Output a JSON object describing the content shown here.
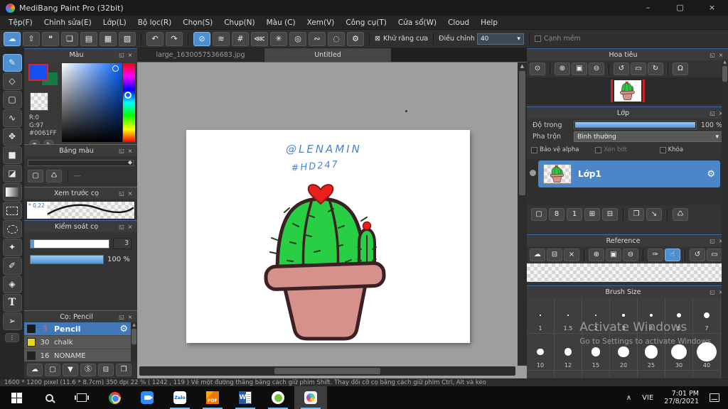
{
  "window": {
    "title": "MediBang Paint Pro (32bit)"
  },
  "menubar": {
    "items": [
      "Tệp(F)",
      "Chỉnh sửa(E)",
      "Lớp(L)",
      "Bộ lọc(R)",
      "Chọn(S)",
      "Chụp(N)",
      "Màu (C)",
      "Xem(V)",
      "Công cụ(T)",
      "Cửa sổ(W)",
      "Cloud",
      "Help"
    ]
  },
  "toolbar": {
    "antialias_label": "Khử răng cưa",
    "adjust_label": "Điều chỉnh",
    "adjust_value": "40",
    "soft_edge_label": "Cạnh mềm"
  },
  "tabs": {
    "tab1": "large_1630057536683.jpg",
    "tab2": "Untitled"
  },
  "canvas": {
    "signature_line1": "@LENAMIN",
    "signature_line2": "#HD247"
  },
  "color_panel": {
    "title": "Màu",
    "r": "R:0",
    "g": "G:97",
    "hex": "#0061FF",
    "fg": "#1650f0",
    "bg": "#157a43"
  },
  "palette_panel": {
    "title": "Bảng màu",
    "empty": "---"
  },
  "preview_panel": {
    "title": "Xem trước cọ",
    "value": "* 0.22"
  },
  "control_panel": {
    "title": "Kiểm soát cọ",
    "size": "3",
    "opacity": "100 %"
  },
  "brush_panel": {
    "title": "Cọ: Pencil",
    "brushes": [
      {
        "size": "3",
        "name": "Pencil",
        "swatch": "#1a1a1a",
        "selected": true
      },
      {
        "size": "30",
        "name": "chalk",
        "swatch": "#e8d51e",
        "selected": false
      },
      {
        "size": "16",
        "name": "NONAME",
        "swatch": "#222222",
        "selected": false
      }
    ]
  },
  "navigator_panel": {
    "title": "Hoa tiêu"
  },
  "layer_panel": {
    "title": "Lớp",
    "opacity_label": "Độ trong",
    "opacity_value": "100 %",
    "blend_label": "Pha trộn",
    "blend_value": "Bình thường",
    "check1": "Bảo vệ alpha",
    "check2": "Xén bớt",
    "check3": "Khóa",
    "layer1": "Lớp1"
  },
  "reference_panel": {
    "title": "Reference"
  },
  "brush_size_panel": {
    "title": "Brush Size",
    "rows": [
      [
        1,
        1.5,
        2,
        3,
        4,
        5,
        7
      ],
      [
        10,
        12,
        15,
        20,
        25,
        30,
        40
      ]
    ],
    "row3_count": 7
  },
  "statusbar": {
    "text": "1600 * 1200 pixel   (11.6 * 8.7cm)   350 dpi   22 %   ( 1242 ,  119 )   Vẽ một đường thẳng bằng cách giữ phím Shift. Thay đổi cỡ cọ bằng cách giữ phím Ctrl, Alt và kéo"
  },
  "watermark": {
    "line1": "Activate Windows",
    "line2": "Go to Settings to activate Windows"
  },
  "taskbar": {
    "language": "VIE",
    "time": "7:01 PM",
    "date": "27/8/2021",
    "zalo_label": "Zalo",
    "pdf_label": "PDF",
    "word_label": "W"
  },
  "colors": {
    "accent_blue": "#4d8fd1",
    "selection_blue": "#4178b8",
    "slider_blue": "#5b9bd5",
    "fg_color": "#0061FF",
    "cactus_green": "#28cf45",
    "pot_pink": "#d6918a",
    "outline_maroon": "#3d1f26",
    "heart_red": "#e8211b"
  },
  "icons": {
    "cloud": "☁",
    "share": "⇧",
    "chat": "❝",
    "comment": "❏",
    "doc": "▤",
    "doc_gear": "▦",
    "material": "▧",
    "undo": "↶",
    "redo": "↷",
    "snap_off": "⊘",
    "snap_para": "≋",
    "snap_grid": "#",
    "snap_vanish": "⋘",
    "snap_radial": "✳",
    "snap_circle": "◎",
    "snap_curve": "∾",
    "snap_ellipse": "◌",
    "gear": "⚙",
    "aa_box": "⊠",
    "dd_arrow": "▾",
    "brush": "✎",
    "eraser": "◇",
    "rect": "▢",
    "polyline": "∿",
    "move": "✥",
    "fill_rect": "■",
    "bucket": "◪",
    "wand": "✦",
    "sel_pen": "✐",
    "sel_eraser": "◈",
    "text_tool": "T",
    "obj": "➢",
    "more": "⋮",
    "zoom_actual": "⊙",
    "zoom_in": "⊕",
    "zoom_fit": "▣",
    "zoom_out": "⊖",
    "rot_ccw": "↺",
    "rot_reset": "▭",
    "rot_cw": "↻",
    "lock": "Ω",
    "close": "×",
    "popout": "◱",
    "folder": "⊟",
    "folder_add": "⊞",
    "dropper": "✑",
    "hand": "☝",
    "new_page": "▢",
    "page8": "8",
    "page1": "1",
    "dup": "❐",
    "transfer": "↘",
    "trash": "♺",
    "save_dd": "▼",
    "s_script": "Ⓢ",
    "diamond": "◆",
    "palette1": "◉",
    "palette2": "✎",
    "min": "–",
    "max": "▢",
    "x": "×",
    "chev_up": "∧",
    "up": "▲",
    "down": "▼"
  }
}
